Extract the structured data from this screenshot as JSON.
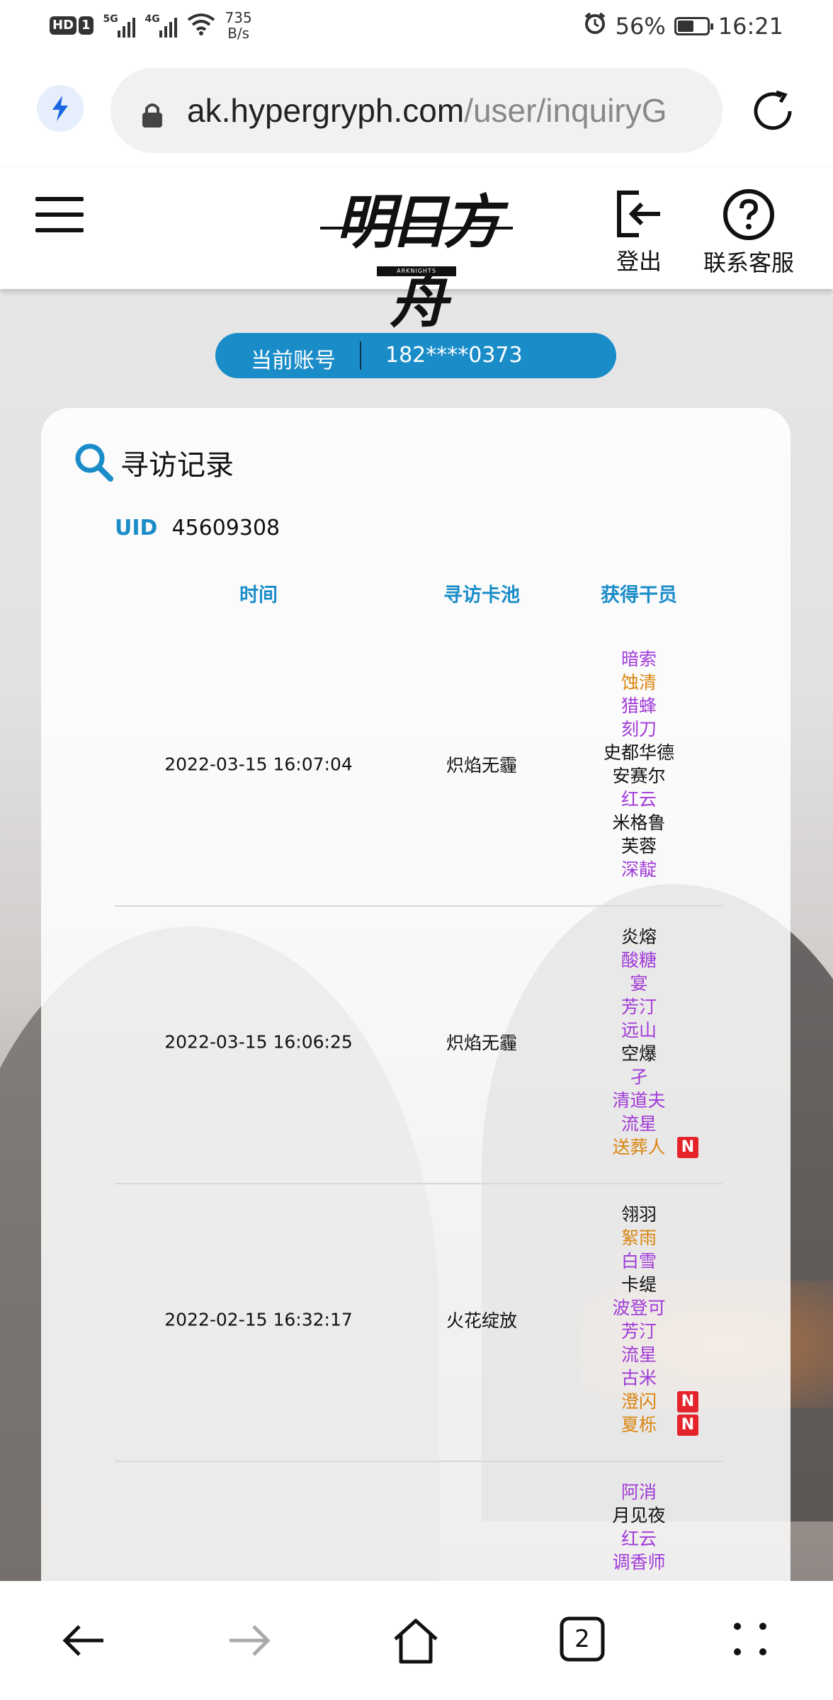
{
  "status_bar": {
    "hd_label": "HD",
    "sim_label": "1",
    "signal1_label": "5G",
    "signal2_label": "4G",
    "speed_value": "735",
    "speed_unit": "B/s",
    "battery_percent": "56%",
    "battery_level": 0.56,
    "time": "16:21"
  },
  "browser": {
    "url_domain": "ak.hypergryph.com",
    "url_path": "/user/inquiryG",
    "tab_count": "2"
  },
  "site_header": {
    "logo_text": "明日方舟",
    "logo_sub": "ARKNIGHTS",
    "logout_label": "登出",
    "support_label": "联系客服"
  },
  "account": {
    "label": "当前账号",
    "value": "182****0373"
  },
  "card": {
    "title": "寻访记录",
    "uid_label": "UID",
    "uid_value": "45609308"
  },
  "table": {
    "headers": [
      "时间",
      "寻访卡池",
      "获得干员"
    ],
    "rows": [
      {
        "time": "2022-03-15 16:07:04",
        "pool": "炽焰无霾",
        "operators": [
          {
            "name": "暗索",
            "rarity": "purple",
            "new": false
          },
          {
            "name": "蚀清",
            "rarity": "gold",
            "new": false
          },
          {
            "name": "猎蜂",
            "rarity": "purple",
            "new": false
          },
          {
            "name": "刻刀",
            "rarity": "purple",
            "new": false
          },
          {
            "name": "史都华德",
            "rarity": "black",
            "new": false
          },
          {
            "name": "安赛尔",
            "rarity": "black",
            "new": false
          },
          {
            "name": "红云",
            "rarity": "purple",
            "new": false
          },
          {
            "name": "米格鲁",
            "rarity": "black",
            "new": false
          },
          {
            "name": "芙蓉",
            "rarity": "black",
            "new": false
          },
          {
            "name": "深靛",
            "rarity": "purple",
            "new": false
          }
        ]
      },
      {
        "time": "2022-03-15 16:06:25",
        "pool": "炽焰无霾",
        "operators": [
          {
            "name": "炎熔",
            "rarity": "black",
            "new": false
          },
          {
            "name": "酸糖",
            "rarity": "purple",
            "new": false
          },
          {
            "name": "宴",
            "rarity": "purple",
            "new": false
          },
          {
            "name": "芳汀",
            "rarity": "purple",
            "new": false
          },
          {
            "name": "远山",
            "rarity": "purple",
            "new": false
          },
          {
            "name": "空爆",
            "rarity": "black",
            "new": false
          },
          {
            "name": "孑",
            "rarity": "purple",
            "new": false
          },
          {
            "name": "清道夫",
            "rarity": "purple",
            "new": false
          },
          {
            "name": "流星",
            "rarity": "purple",
            "new": false
          },
          {
            "name": "送葬人",
            "rarity": "gold",
            "new": true
          }
        ]
      },
      {
        "time": "2022-02-15 16:32:17",
        "pool": "火花绽放",
        "operators": [
          {
            "name": "翎羽",
            "rarity": "black",
            "new": false
          },
          {
            "name": "絮雨",
            "rarity": "gold",
            "new": false
          },
          {
            "name": "白雪",
            "rarity": "purple",
            "new": false
          },
          {
            "name": "卡缇",
            "rarity": "black",
            "new": false
          },
          {
            "name": "波登可",
            "rarity": "purple",
            "new": false
          },
          {
            "name": "芳汀",
            "rarity": "purple",
            "new": false
          },
          {
            "name": "流星",
            "rarity": "purple",
            "new": false
          },
          {
            "name": "古米",
            "rarity": "purple",
            "new": false
          },
          {
            "name": "澄闪",
            "rarity": "gold",
            "new": true
          },
          {
            "name": "夏栎",
            "rarity": "gold",
            "new": true
          }
        ]
      },
      {
        "time": "",
        "pool": "",
        "operators": [
          {
            "name": "阿消",
            "rarity": "purple",
            "new": false
          },
          {
            "name": "月见夜",
            "rarity": "black",
            "new": false
          },
          {
            "name": "红云",
            "rarity": "purple",
            "new": false
          },
          {
            "name": "调香师",
            "rarity": "purple",
            "new": false
          }
        ]
      }
    ],
    "new_badge_label": "N"
  },
  "colors": {
    "accent": "#1a8dc9",
    "rarity_black": "#111111",
    "rarity_purple": "#a03ad8",
    "rarity_gold": "#d9850f",
    "new_badge": "#e5232a"
  },
  "icons": {
    "bolt": "bolt-icon",
    "lock": "lock-icon",
    "reload": "reload-icon",
    "menu": "hamburger-menu-icon",
    "logout": "logout-icon",
    "support": "question-circle-icon",
    "search": "search-icon",
    "back": "back-arrow-icon",
    "forward": "forward-arrow-icon",
    "home": "home-icon",
    "tabs": "tabs-icon",
    "more": "more-dots-icon"
  }
}
